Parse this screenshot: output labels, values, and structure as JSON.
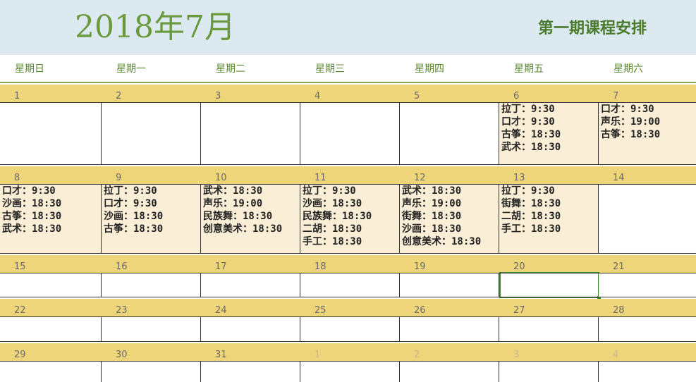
{
  "header": {
    "title": "2018年7月",
    "subtitle": "第一期课程安排"
  },
  "weekdays": [
    "星期日",
    "星期一",
    "星期二",
    "星期三",
    "星期四",
    "星期五",
    "星期六"
  ],
  "weeks": [
    {
      "days": [
        {
          "num": "1",
          "events": []
        },
        {
          "num": "2",
          "events": []
        },
        {
          "num": "3",
          "events": []
        },
        {
          "num": "4",
          "events": []
        },
        {
          "num": "5",
          "events": []
        },
        {
          "num": "6",
          "events": [
            "拉丁：9:30",
            "口才：9:30",
            "古筝：18:30",
            "武术：18:30"
          ]
        },
        {
          "num": "7",
          "events": [
            "口才：9:30",
            "声乐：19:00",
            "古筝：18:30"
          ]
        }
      ]
    },
    {
      "days": [
        {
          "num": "8",
          "events": [
            "口才：9:30",
            "沙画：18:30",
            "古筝：18:30",
            "武术：18:30"
          ]
        },
        {
          "num": "9",
          "events": [
            "拉丁：9:30",
            "口才：9:30",
            "沙画：18:30",
            "古筝：18:30"
          ]
        },
        {
          "num": "10",
          "events": [
            "武术：18:30",
            "声乐：19:00",
            "民族舞：18:30",
            "创意美术：18:30"
          ]
        },
        {
          "num": "11",
          "events": [
            "拉丁：9:30",
            "沙画：18:30",
            "民族舞：18:30",
            "二胡：18:30",
            "手工：18:30"
          ]
        },
        {
          "num": "12",
          "events": [
            "武术：18:30",
            "声乐：19:00",
            "街舞：18:30",
            "沙画：18:30",
            "创意美术：18:30"
          ]
        },
        {
          "num": "13",
          "events": [
            "拉丁：9:30",
            "街舞：18:30",
            "二胡：18:30",
            "手工：18:30"
          ]
        },
        {
          "num": "14",
          "events": []
        }
      ]
    },
    {
      "days": [
        {
          "num": "15",
          "events": []
        },
        {
          "num": "16",
          "events": []
        },
        {
          "num": "17",
          "events": []
        },
        {
          "num": "18",
          "events": []
        },
        {
          "num": "19",
          "events": []
        },
        {
          "num": "20",
          "events": [],
          "selected": true
        },
        {
          "num": "21",
          "events": []
        }
      ]
    },
    {
      "days": [
        {
          "num": "22",
          "events": []
        },
        {
          "num": "23",
          "events": []
        },
        {
          "num": "24",
          "events": []
        },
        {
          "num": "25",
          "events": []
        },
        {
          "num": "26",
          "events": []
        },
        {
          "num": "27",
          "events": []
        },
        {
          "num": "28",
          "events": []
        }
      ]
    },
    {
      "days": [
        {
          "num": "29",
          "events": []
        },
        {
          "num": "30",
          "events": []
        },
        {
          "num": "31",
          "events": []
        },
        {
          "num": "1",
          "events": [],
          "other_month": true
        },
        {
          "num": "2",
          "events": [],
          "other_month": true
        },
        {
          "num": "3",
          "events": [],
          "other_month": true
        },
        {
          "num": "4",
          "events": [],
          "other_month": true
        }
      ]
    }
  ]
}
